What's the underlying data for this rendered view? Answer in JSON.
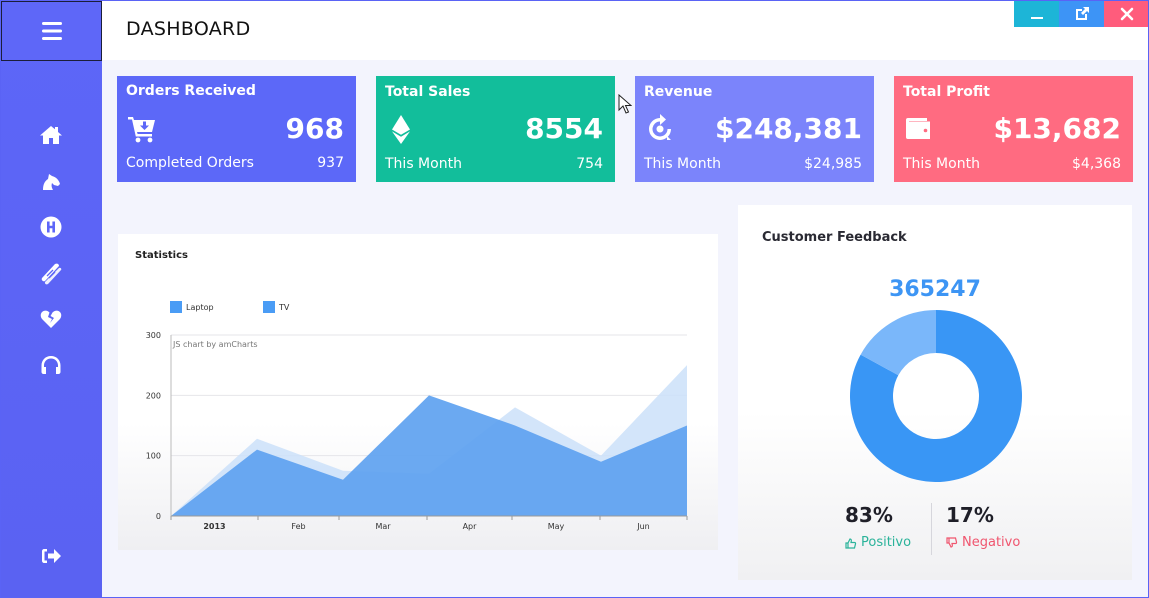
{
  "header": {
    "title": "DASHBOARD",
    "window_controls": [
      "minimize",
      "popout",
      "close"
    ]
  },
  "sidebar": {
    "menu_icon": "hamburger-icon",
    "items": [
      {
        "name": "home",
        "icon": "home-icon"
      },
      {
        "name": "horse",
        "icon": "horse-head-icon"
      },
      {
        "name": "hospital",
        "icon": "hospital-h-icon"
      },
      {
        "name": "hotdog",
        "icon": "hotdog-icon"
      },
      {
        "name": "heart-broken",
        "icon": "heart-broken-icon"
      },
      {
        "name": "support",
        "icon": "headphones-icon"
      }
    ],
    "logout_icon": "sign-out-icon"
  },
  "cards": [
    {
      "title": "Orders Received",
      "icon": "cart-arrow-down-icon",
      "value": "968",
      "sub_label": "Completed Orders",
      "sub_value": "937",
      "color": "#5c68f8"
    },
    {
      "title": "Total Sales",
      "icon": "ethereum-icon",
      "value": "8554",
      "sub_label": "This Month",
      "sub_value": "754",
      "color": "#12be9b"
    },
    {
      "title": "Revenue",
      "icon": "refresh-target-icon",
      "value": "$248,381",
      "sub_label": "This Month",
      "sub_value": "$24,985",
      "color": "#7b84fb"
    },
    {
      "title": "Total Profit",
      "icon": "wallet-icon",
      "value": "$13,682",
      "sub_label": "This Month",
      "sub_value": "$4,368",
      "color": "#ff6b81"
    }
  ],
  "statistics": {
    "title": "Statistics",
    "credit": "JS chart by amCharts"
  },
  "feedback": {
    "title": "Customer Feedback",
    "total": "365247",
    "positive_pct": "83%",
    "positive_label": "Positivo",
    "negative_pct": "17%",
    "negative_label": "Negativo",
    "colors": {
      "positive": "#3996f5",
      "negative": "#7ab7fa"
    }
  },
  "chart_data": [
    {
      "type": "area",
      "title": "Statistics",
      "categories": [
        "2013",
        "Feb",
        "Mar",
        "Apr",
        "May",
        "Jun",
        ""
      ],
      "x_ticks": [
        "2013",
        "Feb",
        "Mar",
        "Apr",
        "May",
        "Jun"
      ],
      "series": [
        {
          "name": "Laptop",
          "values": [
            0,
            110,
            60,
            200,
            150,
            90,
            150
          ],
          "color": "#5ea2f0"
        },
        {
          "name": "TV",
          "values": [
            0,
            128,
            75,
            70,
            180,
            100,
            250
          ],
          "color": "#cbe0f9"
        }
      ],
      "y_ticks": [
        0,
        100,
        200,
        300
      ],
      "ylim": [
        0,
        300
      ],
      "grid": true,
      "legend": "top-left",
      "xlabel": "",
      "ylabel": ""
    },
    {
      "type": "pie",
      "title": "Customer Feedback",
      "labels": [
        "Positivo",
        "Negativo"
      ],
      "values": [
        83,
        17
      ],
      "donut": true
    }
  ]
}
